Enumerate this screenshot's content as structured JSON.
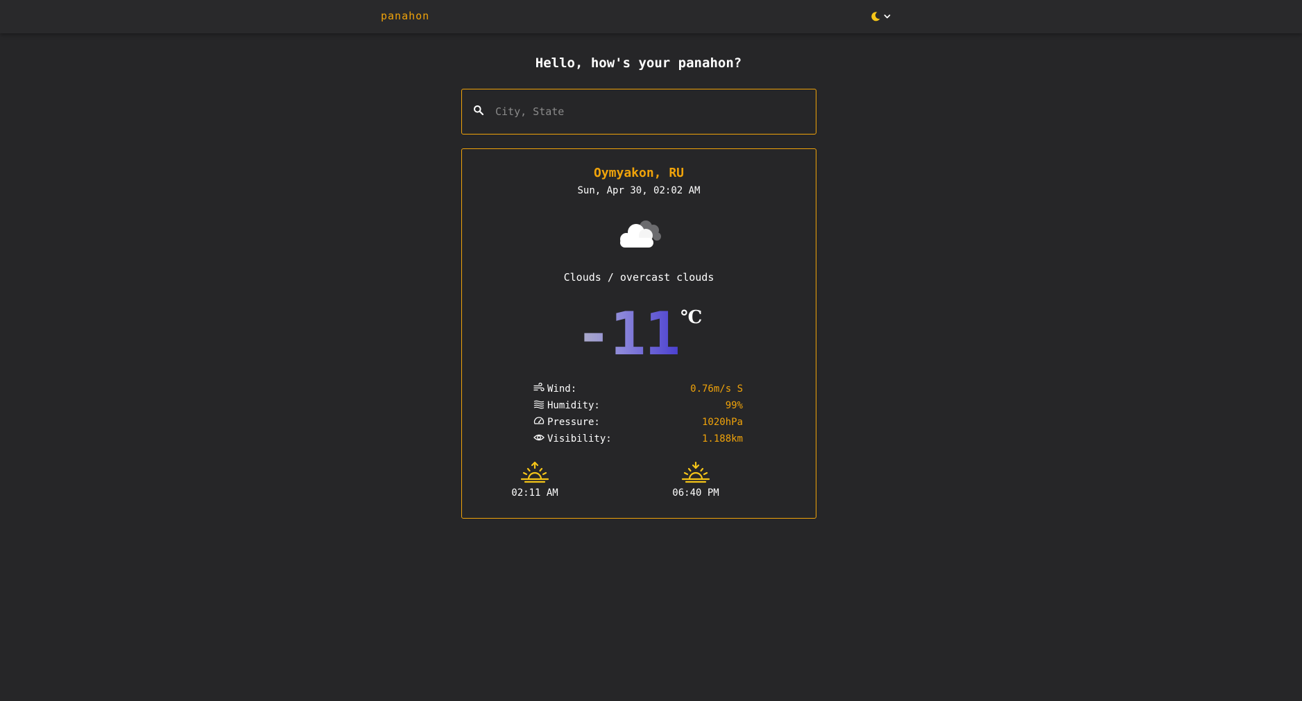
{
  "header": {
    "brand": "panahon",
    "theme_icon": "moon-icon",
    "dropdown_icon": "chevron-down-icon",
    "accent_color": "#f0a30a"
  },
  "greeting": "Hello, how's your panahon?",
  "search": {
    "placeholder": "City, State",
    "value": "",
    "icon": "search-icon"
  },
  "weather": {
    "location": "Oymyakon, RU",
    "datetime": "Sun, Apr 30, 02:02 AM",
    "icon": "cloud-icon",
    "condition": "Clouds / overcast clouds",
    "temperature": "-11",
    "unit": "℃",
    "details": [
      {
        "icon": "wind-icon",
        "label": "Wind:",
        "value": "0.76m/s S"
      },
      {
        "icon": "humidity-icon",
        "label": "Humidity:",
        "value": "99%"
      },
      {
        "icon": "pressure-gauge-icon",
        "label": "Pressure:",
        "value": "1020hPa"
      },
      {
        "icon": "eye-icon",
        "label": "Visibility:",
        "value": "1.188km"
      }
    ],
    "sunrise": {
      "icon": "sunrise-icon",
      "time": "02:11 AM"
    },
    "sunset": {
      "icon": "sunset-icon",
      "time": "06:40 PM"
    }
  }
}
